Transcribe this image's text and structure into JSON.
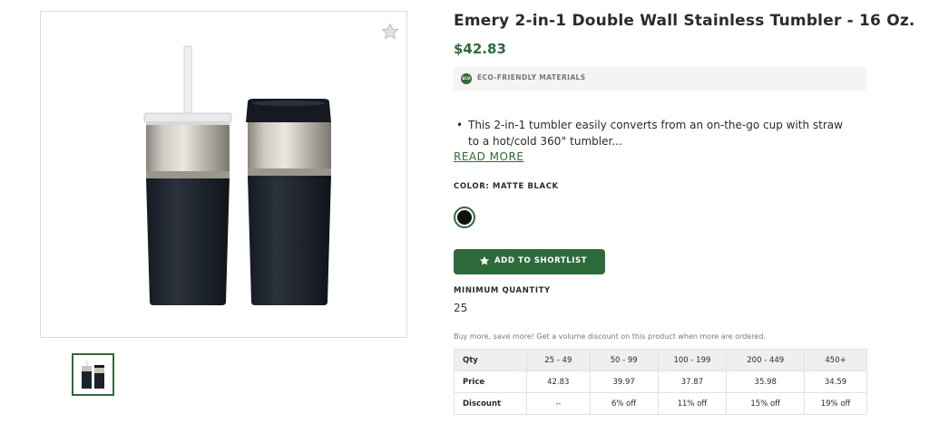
{
  "product": {
    "title": "Emery 2-in-1 Double Wall Stainless Tumbler - 16 Oz.",
    "price": "$42.83",
    "eco_badge_text": "ECO",
    "eco_label": "ECO-FRIENDLY MATERIALS",
    "description": "This 2-in-1 tumbler easily converts from an on-the-go cup with straw to a hot/cold 360° tumbler...",
    "read_more": "READ MORE",
    "color_label": "COLOR: MATTE BLACK",
    "swatch_color": "#111111",
    "shortlist_button": "ADD TO SHORTLIST",
    "min_quantity_label": "MINIMUM QUANTITY",
    "min_quantity_value": "25",
    "volume_note": "Buy more, save more! Get a volume discount on this product when more are ordered."
  },
  "colors": {
    "accent": "#2e6b3b",
    "table_header_bg": "#eef0ed"
  },
  "icons": {
    "favorite": "star-icon",
    "shortlist": "star-icon",
    "eco": "eco-leaf-icon"
  },
  "pricing_table": {
    "header": [
      "Qty",
      "25 - 49",
      "50 - 99",
      "100 - 199",
      "200 - 449",
      "450+"
    ],
    "price": [
      "Price",
      "42.83",
      "39.97",
      "37.87",
      "35.98",
      "34.59"
    ],
    "discount": [
      "Discount",
      "--",
      "6% off",
      "11% off",
      "15% off",
      "19% off"
    ]
  }
}
